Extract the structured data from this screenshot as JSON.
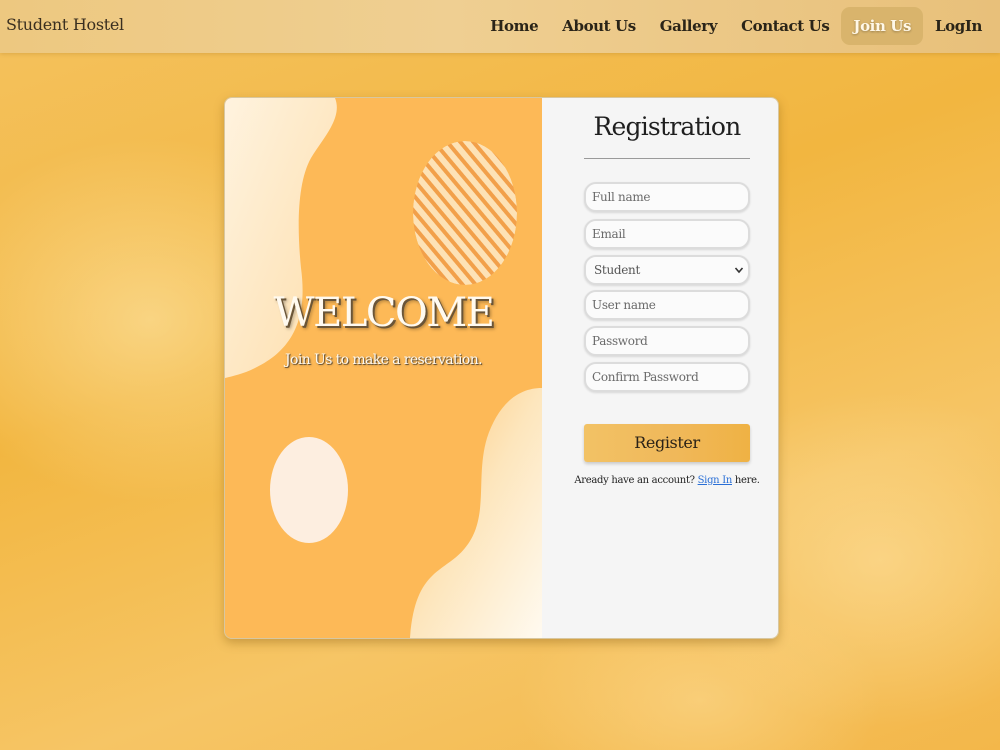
{
  "navbar": {
    "brand": "Student Hostel",
    "links": [
      {
        "label": "Home"
      },
      {
        "label": "About Us"
      },
      {
        "label": "Gallery"
      },
      {
        "label": "Contact Us"
      },
      {
        "label": "Join Us",
        "active": true
      },
      {
        "label": "LogIn"
      }
    ]
  },
  "welcome": {
    "title": "WELCOME",
    "subtitle": "Join Us to make a reservation."
  },
  "form": {
    "title": "Registration",
    "fullname_placeholder": "Full name",
    "email_placeholder": "Email",
    "role_selected": "Student",
    "username_placeholder": "User name",
    "password_placeholder": "Password",
    "confirm_password_placeholder": "Confirm Password",
    "register_label": "Register",
    "signin_prefix": "Aready have an account?",
    "signin_link": "Sign In",
    "signin_suffix": "here."
  },
  "colors": {
    "background": "#f2b640",
    "navbar": "#efcf92",
    "left_panel": "#fdb957",
    "right_panel": "#f5f5f5",
    "active_nav": "#d9b46c",
    "link": "#2a6fd6"
  },
  "icons": {
    "select_chevron": "chevron-down-icon"
  }
}
